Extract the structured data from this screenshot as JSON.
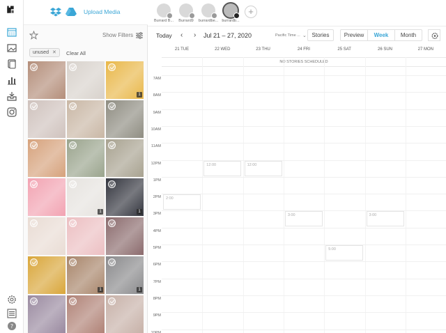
{
  "rail": {
    "logo": "app-logo",
    "icons": [
      "calendar-icon",
      "media-icon",
      "stories-icon",
      "analytics-icon",
      "inbox-icon",
      "instagram-icon"
    ],
    "bottom": [
      "settings-icon",
      "list-icon",
      "help-icon"
    ]
  },
  "media": {
    "upload_label": "Upload Media",
    "show_filters": "Show Filters",
    "chip_label": "unused",
    "chip_close": "✕",
    "clear_all": "Clear All",
    "thumbs": [
      {
        "c": "#b48e7a",
        "badge": ""
      },
      {
        "c": "#d8d2cc",
        "badge": ""
      },
      {
        "c": "#e9b84a",
        "badge": "1"
      },
      {
        "c": "#cfc2bd",
        "badge": ""
      },
      {
        "c": "#c9b7a5",
        "badge": ""
      },
      {
        "c": "#8f8d82",
        "badge": ""
      },
      {
        "c": "#d6a27c",
        "badge": ""
      },
      {
        "c": "#9aa48d",
        "badge": ""
      },
      {
        "c": "#a8a290",
        "badge": ""
      },
      {
        "c": "#f2a3b2",
        "badge": ""
      },
      {
        "c": "#e6e3df",
        "badge": "1"
      },
      {
        "c": "#34363f",
        "badge": "1"
      },
      {
        "c": "#e9dcd4",
        "badge": ""
      },
      {
        "c": "#ecbfc2",
        "badge": ""
      },
      {
        "c": "#8b6b6d",
        "badge": ""
      },
      {
        "c": "#d9a63a",
        "badge": ""
      },
      {
        "c": "#a8856a",
        "badge": "1"
      },
      {
        "c": "#8a8a8c",
        "badge": "1"
      },
      {
        "c": "#9a8aa0",
        "badge": ""
      },
      {
        "c": "#b08276",
        "badge": ""
      },
      {
        "c": "#c7b1a8",
        "badge": ""
      }
    ]
  },
  "profiles": [
    {
      "name": "Burrard B...",
      "net": "f"
    },
    {
      "name": "Burrard9",
      "net": "t"
    },
    {
      "name": "burrardbe...",
      "net": "p"
    },
    {
      "name": "burrardb...",
      "net": "ig",
      "active": true
    }
  ],
  "toolbar": {
    "today": "Today",
    "prev": "‹",
    "next": "›",
    "range": "Jul 21 – 27, 2020",
    "timezone": "Pacific Time ...",
    "tz_chevron": "⌄",
    "stories": "Stories",
    "preview": "Preview",
    "week": "Week",
    "month": "Month"
  },
  "calendar": {
    "days": [
      "21 TUE",
      "22 WED",
      "23 THU",
      "24 FRI",
      "25 SAT",
      "26 SUN",
      "27 MON"
    ],
    "no_stories": "NO STORIES SCHEDULED",
    "hours": [
      "7AM",
      "8AM",
      "9AM",
      "10AM",
      "11AM",
      "12PM",
      "1PM",
      "2PM",
      "3PM",
      "4PM",
      "5PM",
      "6PM",
      "7PM",
      "8PM",
      "9PM",
      "10PM"
    ],
    "slots": [
      {
        "day": 1,
        "hour": 5,
        "label": "12:00"
      },
      {
        "day": 2,
        "hour": 5,
        "label": "12:00"
      },
      {
        "day": 0,
        "hour": 7,
        "label": "2:00"
      },
      {
        "day": 3,
        "hour": 8,
        "label": "3:00"
      },
      {
        "day": 5,
        "hour": 8,
        "label": "3:00"
      },
      {
        "day": 4,
        "hour": 10,
        "label": "5:00"
      }
    ]
  }
}
